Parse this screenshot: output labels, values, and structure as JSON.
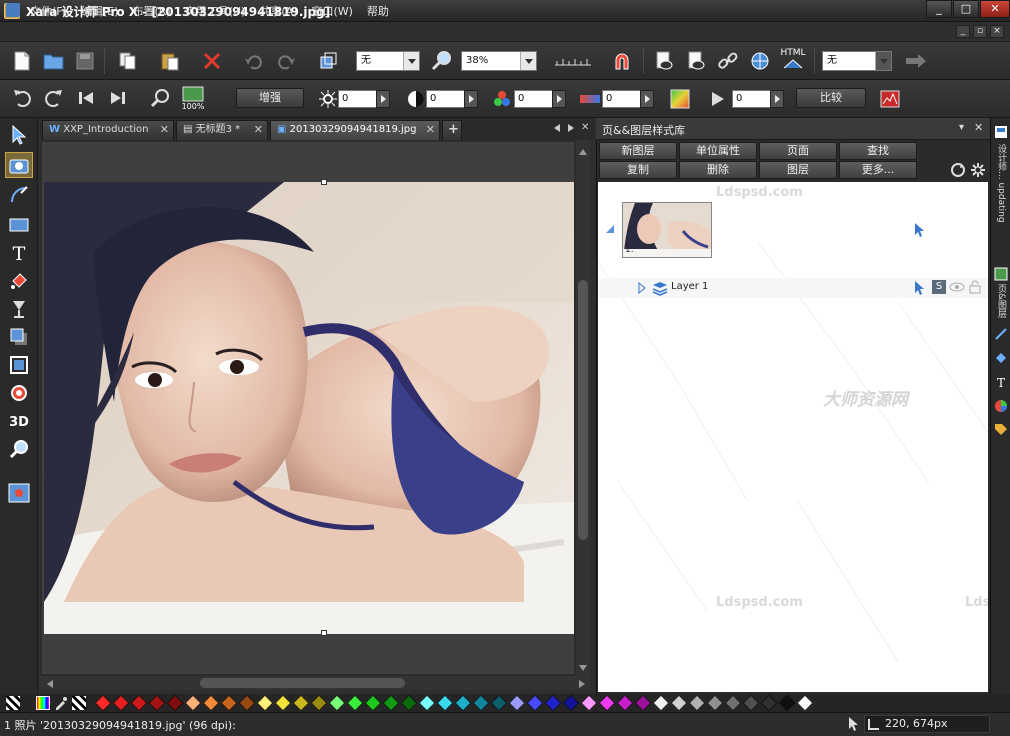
{
  "title_bar": {
    "app_badge": "D",
    "title": "Xara 设计师 Pro X - [20130329094941819.jpg]",
    "min": "_",
    "max": "□",
    "close": "✕"
  },
  "menu": {
    "items": [
      "文件(F)",
      "编辑(E)",
      "布置(R)",
      "实用工具(U)",
      "共享(A)",
      "窗口(W)",
      "帮助"
    ],
    "mdi": [
      "_",
      "▫",
      "×"
    ]
  },
  "toolbar1": {
    "quality_value": "无",
    "zoom_value": "38%",
    "html_label": "HTML",
    "right_combo": "无"
  },
  "toolbar2": {
    "enhance_label": "增强",
    "brightness": "0",
    "contrast": "0",
    "saturation": "0",
    "temperature": "0",
    "sharpness": "0",
    "compare_label": "比较"
  },
  "tabs": [
    {
      "prefix": "W",
      "label": "XXP_Introduction",
      "close": "✕"
    },
    {
      "prefix": "▤",
      "label": "无标题3 *",
      "close": "✕"
    },
    {
      "prefix": "▣",
      "label": "20130329094941819.jpg",
      "close": "✕"
    }
  ],
  "tabs_add": "+",
  "panel": {
    "title": "页&&图层样式库",
    "row1": [
      "新图层",
      "单位属性",
      "页面",
      "查找"
    ],
    "row2": [
      "复制",
      "删除",
      "图层",
      "更多..."
    ],
    "page_number": "1.",
    "layer_name": "Layer 1",
    "layer_s_badge": "S"
  },
  "right_strip": {
    "label_top": "设计师... updating",
    "label_mid": "页&图层"
  },
  "watermarks": {
    "latin": "Ldspsd.com",
    "chinese": "大师资源网"
  },
  "status": {
    "text": "1 照片 '20130329094941819.jpg' (96 dpi):",
    "coords": "220, 674px"
  },
  "palette_colors": [
    "#ff2a2a",
    "#e62020",
    "#cc1a1a",
    "#a51212",
    "#7f0c0c",
    "#ffb07a",
    "#f28a3a",
    "#c9641e",
    "#9a4a12",
    "#fff07a",
    "#f2e23a",
    "#c9b91e",
    "#9a8c12",
    "#7aff7a",
    "#3aee3a",
    "#1ec91e",
    "#129a12",
    "#0c6a0c",
    "#7affff",
    "#3ad9ee",
    "#1eaec9",
    "#12869a",
    "#0c5e6a",
    "#9a9aff",
    "#4a4aff",
    "#2020cc",
    "#12129a",
    "#ff9aff",
    "#ee3aee",
    "#c91ec9",
    "#9a129a",
    "#f0f0f0",
    "#d0d0d0",
    "#b0b0b0",
    "#909090",
    "#707070",
    "#505050",
    "#303030",
    "#101010",
    "#ffffff"
  ]
}
